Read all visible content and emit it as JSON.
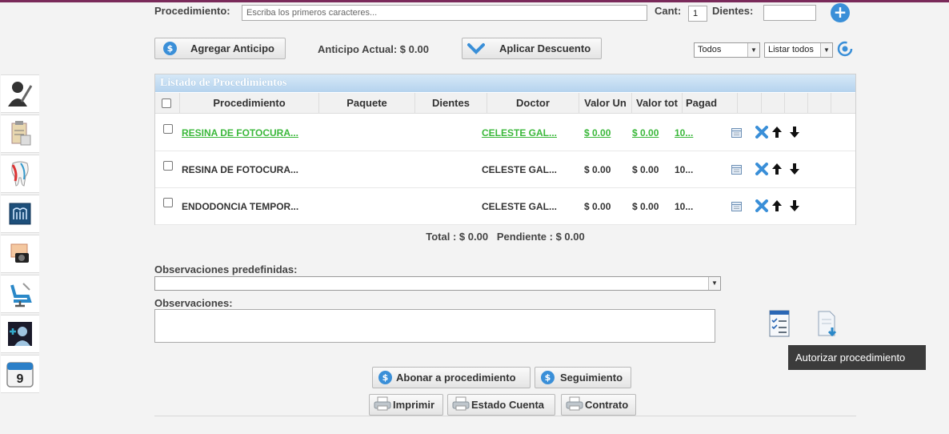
{
  "form": {
    "procedimiento_label": "Procedimiento:",
    "procedimiento_placeholder": "Escriba los primeros caracteres...",
    "cant_label": "Cant:",
    "cant_value": "1",
    "dientes_label": "Dientes:",
    "dientes_value": ""
  },
  "toolbar": {
    "agregar_anticipo": "Agregar Anticipo",
    "anticipo_actual": "Anticipo Actual: $ 0.00",
    "aplicar_descuento": "Aplicar Descuento",
    "filter_select": "Todos",
    "list_select": "Listar todos"
  },
  "table": {
    "title": "Listado de Procedimientos",
    "headers": [
      "Procedimiento",
      "Paquete",
      "Dientes",
      "Doctor",
      "Valor Un",
      "Valor tot",
      "Pagad"
    ],
    "rows": [
      {
        "procedimiento": "RESINA DE FOTOCURA...",
        "paquete": "",
        "dientes": "",
        "doctor": "CELESTE GAL...",
        "valor_un": "$ 0.00",
        "valor_tot": "$ 0.00",
        "pagado": "10...",
        "highlight": true
      },
      {
        "procedimiento": "RESINA DE FOTOCURA...",
        "paquete": "",
        "dientes": "",
        "doctor": "CELESTE GAL...",
        "valor_un": "$ 0.00",
        "valor_tot": "$ 0.00",
        "pagado": "10...",
        "highlight": false
      },
      {
        "procedimiento": "ENDODONCIA TEMPOR...",
        "paquete": "",
        "dientes": "",
        "doctor": "CELESTE GAL...",
        "valor_un": "$ 0.00",
        "valor_tot": "$ 0.00",
        "pagado": "10...",
        "highlight": false
      }
    ]
  },
  "totals": {
    "text": "Total : $ 0.00   Pendiente : $ 0.00"
  },
  "observaciones": {
    "predefinidas_label": "Observaciones predefinidas:",
    "label": "Observaciones:",
    "value": ""
  },
  "actions": {
    "abonar": "Abonar a procedimiento",
    "seguimiento": "Seguimiento",
    "imprimir": "Imprimir",
    "estado_cuenta": "Estado Cuenta",
    "contrato": "Contrato"
  },
  "tooltip": "Autorizar procedimiento",
  "sidebar_icons": [
    "doctor-pen-icon",
    "clipboard-notes-icon",
    "tooth-icon",
    "panoramic-xray-icon",
    "photo-camera-icon",
    "dental-chair-icon",
    "monitor-xray-icon",
    "calendar-icon"
  ],
  "calendar_day": "9",
  "colors": {
    "header_bar": "#7a2a5a",
    "accent_blue": "#3a8fd8",
    "link_green": "#3bb83b",
    "table_head": "#b5d3ee"
  }
}
